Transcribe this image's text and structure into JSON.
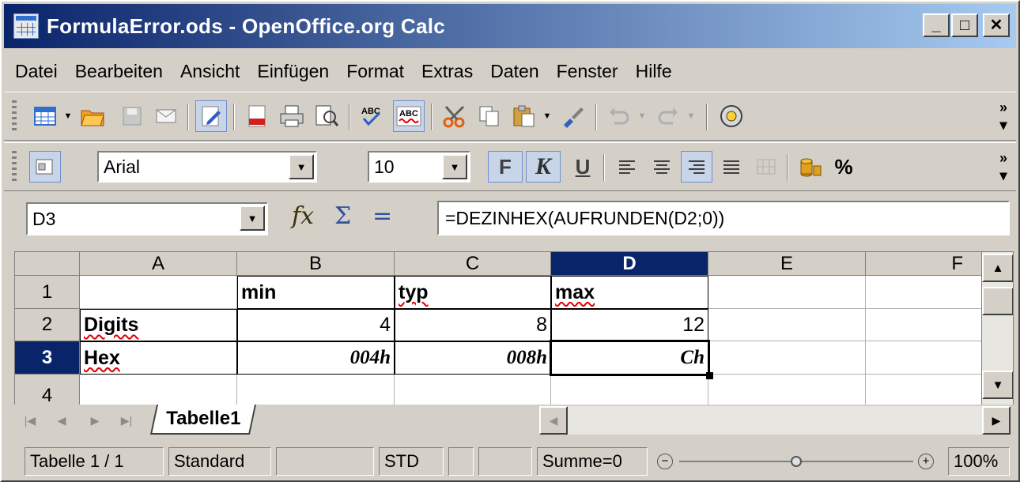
{
  "window": {
    "title": "FormulaError.ods - OpenOffice.org Calc",
    "min_label": "_",
    "max_label": "□",
    "close_label": "✕"
  },
  "menu": [
    "Datei",
    "Bearbeiten",
    "Ansicht",
    "Einfügen",
    "Format",
    "Extras",
    "Daten",
    "Fenster",
    "Hilfe"
  ],
  "toolbar1": {
    "icons": [
      "new-document-icon",
      "open-folder-icon",
      "save-icon",
      "email-icon",
      "edit-file-icon",
      "export-pdf-icon",
      "print-icon",
      "page-preview-icon",
      "spellcheck-icon",
      "autospellcheck-icon",
      "cut-icon",
      "copy-icon",
      "paste-icon",
      "format-paintbrush-icon",
      "undo-icon",
      "redo-icon",
      "navigator-icon"
    ],
    "overflow": "»"
  },
  "toolbar2": {
    "font_name": "Arial",
    "font_size": "10",
    "bold_label": "F",
    "italic_label": "K",
    "underline_label": "U",
    "percent_label": "%",
    "overflow": "»"
  },
  "formula_bar": {
    "cell_ref": "D3",
    "fx_label": "fx",
    "sum_label": "Σ",
    "equals_label": "=",
    "formula": "=DEZINHEX(AUFRUNDEN(D2;0))"
  },
  "sheet": {
    "columns": [
      "A",
      "B",
      "C",
      "D",
      "E",
      "F"
    ],
    "rows": [
      "1",
      "2",
      "3",
      "4"
    ],
    "selected_column": "D",
    "selected_row": "3",
    "cells": {
      "B1": "min",
      "C1": "typ",
      "D1": "max",
      "A2": "Digits",
      "B2": "4",
      "C2": "8",
      "D2": "12",
      "A3": "Hex",
      "B3": "004h",
      "C3": "008h",
      "D3": "Ch"
    }
  },
  "tabs": {
    "active": "Tabelle1"
  },
  "status": {
    "sheet": "Tabelle 1 / 1",
    "page_style": "Standard",
    "empty1": "",
    "mode": "STD",
    "empty2": "",
    "empty3": "",
    "sum": "Summe=0",
    "zoom_minus": "−",
    "zoom_plus": "+",
    "zoom": "100%",
    "zoom_slider_fraction": 0.5
  }
}
